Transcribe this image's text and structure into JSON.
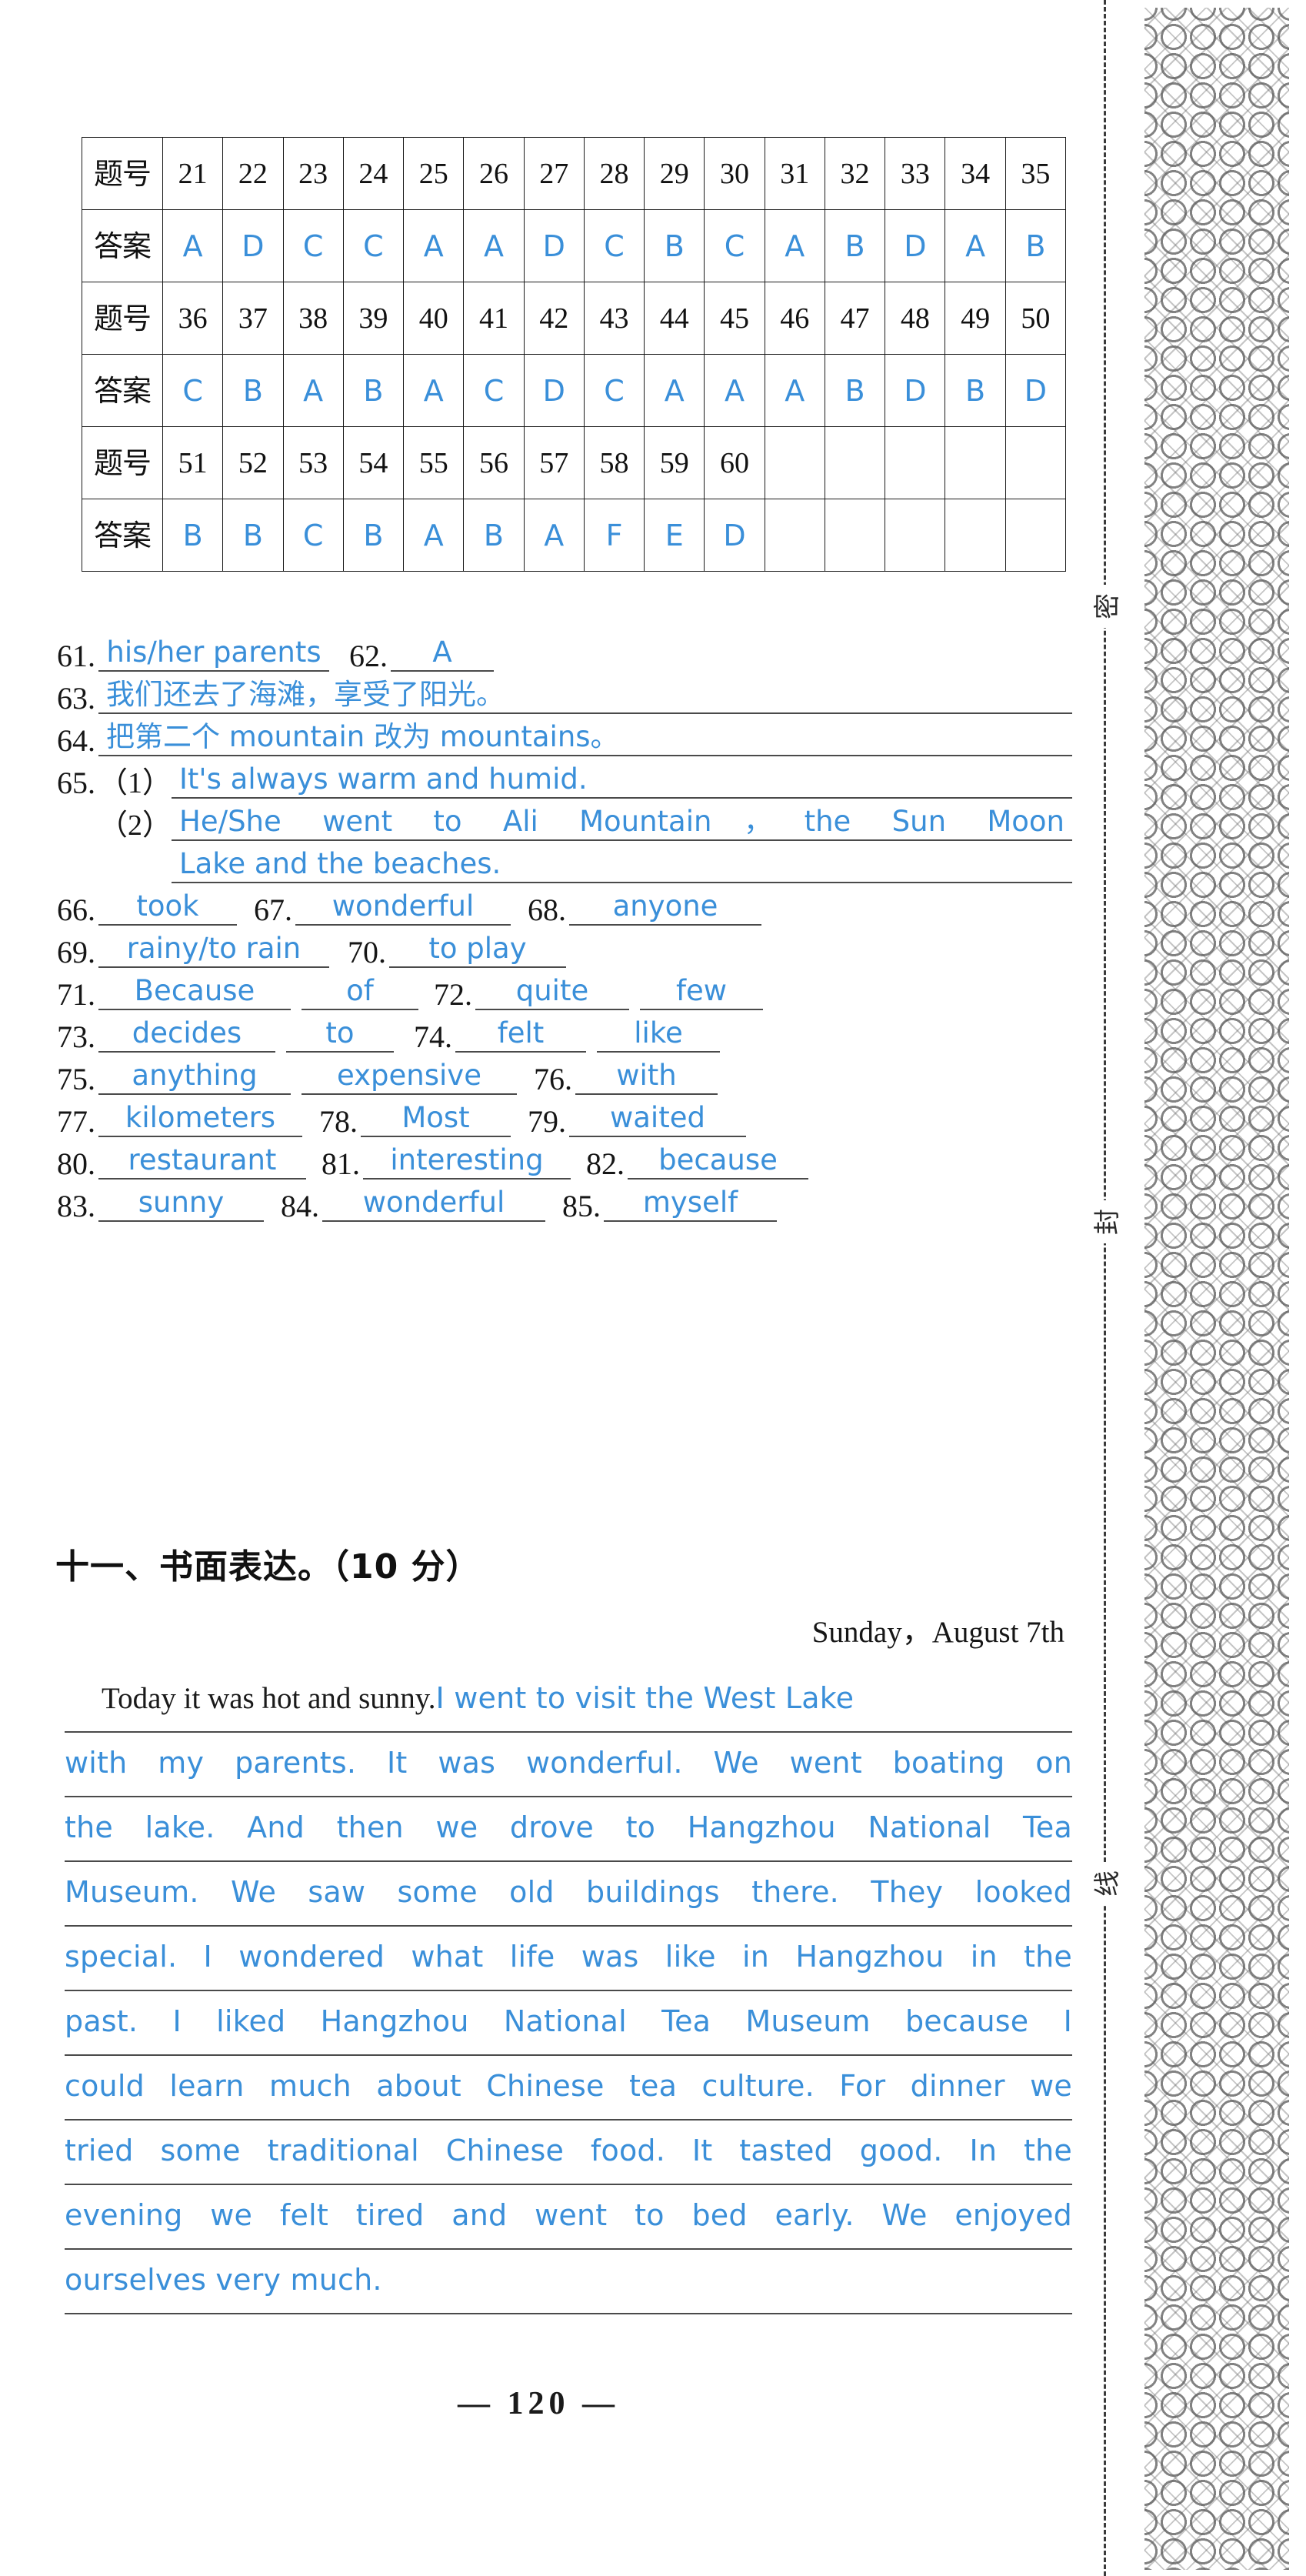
{
  "answer_table": {
    "row_label_number": "题号",
    "row_label_answer": "答案",
    "blocks": [
      {
        "numbers": [
          "21",
          "22",
          "23",
          "24",
          "25",
          "26",
          "27",
          "28",
          "29",
          "30",
          "31",
          "32",
          "33",
          "34",
          "35"
        ],
        "answers": [
          "A",
          "D",
          "C",
          "C",
          "A",
          "A",
          "D",
          "C",
          "B",
          "C",
          "A",
          "B",
          "D",
          "A",
          "B"
        ]
      },
      {
        "numbers": [
          "36",
          "37",
          "38",
          "39",
          "40",
          "41",
          "42",
          "43",
          "44",
          "45",
          "46",
          "47",
          "48",
          "49",
          "50"
        ],
        "answers": [
          "C",
          "B",
          "A",
          "B",
          "A",
          "C",
          "D",
          "C",
          "A",
          "A",
          "A",
          "B",
          "D",
          "B",
          "D"
        ]
      },
      {
        "numbers": [
          "51",
          "52",
          "53",
          "54",
          "55",
          "56",
          "57",
          "58",
          "59",
          "60",
          "",
          "",
          "",
          "",
          ""
        ],
        "answers": [
          "B",
          "B",
          "C",
          "B",
          "A",
          "B",
          "A",
          "F",
          "E",
          "D",
          "",
          "",
          "",
          "",
          ""
        ]
      }
    ]
  },
  "short_answers": {
    "q61": {
      "num": "61.",
      "answer": "his/her parents"
    },
    "q62": {
      "num": "62.",
      "answer": "A"
    },
    "q63": {
      "num": "63.",
      "answer": "我们还去了海滩，享受了阳光。"
    },
    "q64": {
      "num": "64.",
      "answer": "把第二个 mountain 改为 mountains。"
    },
    "q65": {
      "num": "65.",
      "sub1_label": "（1）",
      "sub1_answer": "It's always warm and humid.",
      "sub2_label": "（2）",
      "sub2_answer_line1": "He/She went to Ali Mountain，the Sun Moon",
      "sub2_answer_line2": "Lake and the beaches."
    },
    "q66": {
      "num": "66.",
      "answer": "took"
    },
    "q67": {
      "num": "67.",
      "answer": "wonderful"
    },
    "q68": {
      "num": "68.",
      "answer": "anyone"
    },
    "q69": {
      "num": "69.",
      "answer": "rainy/to rain"
    },
    "q70": {
      "num": "70.",
      "answer": "to play"
    },
    "q71": {
      "num": "71.",
      "answer_a": "Because",
      "answer_b": "of"
    },
    "q72": {
      "num": "72.",
      "answer_a": "quite",
      "answer_b": "few"
    },
    "q73": {
      "num": "73.",
      "answer_a": "decides",
      "answer_b": "to"
    },
    "q74": {
      "num": "74.",
      "answer_a": "felt",
      "answer_b": "like"
    },
    "q75": {
      "num": "75.",
      "answer_a": "anything",
      "answer_b": "expensive"
    },
    "q76": {
      "num": "76.",
      "answer": "with"
    },
    "q77": {
      "num": "77.",
      "answer": "kilometers"
    },
    "q78": {
      "num": "78.",
      "answer": "Most"
    },
    "q79": {
      "num": "79.",
      "answer": "waited"
    },
    "q80": {
      "num": "80.",
      "answer": "restaurant"
    },
    "q81": {
      "num": "81.",
      "answer": "interesting"
    },
    "q82": {
      "num": "82.",
      "answer": "because"
    },
    "q83": {
      "num": "83.",
      "answer": "sunny"
    },
    "q84": {
      "num": "84.",
      "answer": "wonderful"
    },
    "q85": {
      "num": "85.",
      "answer": "myself"
    }
  },
  "section_heading": "十一、书面表达。（10 分）",
  "composition": {
    "date": "Sunday，August 7th",
    "printed_opening": "Today it was hot and sunny.",
    "lines": [
      "I went to visit the West Lake",
      "with my parents. It was wonderful. We went boating on",
      "the lake. And then we drove to Hangzhou National Tea",
      "Museum. We saw some old buildings there. They looked",
      "special. I wondered what life was like in Hangzhou in the",
      "past. I liked Hangzhou National Tea Museum because I",
      "could learn much about Chinese tea culture. For dinner we",
      "tried some traditional Chinese food. It tasted good. In the",
      "evening we felt tired and went to bed early. We enjoyed",
      "ourselves very much."
    ]
  },
  "footer": {
    "page_number": "— 120 —"
  },
  "right_margin": {
    "seal_chars": [
      "密",
      "封",
      "线"
    ]
  },
  "colors": {
    "handwriting_blue": "#3a8fd9",
    "print_black": "#161616",
    "rule_gray": "#4a4a4a"
  }
}
